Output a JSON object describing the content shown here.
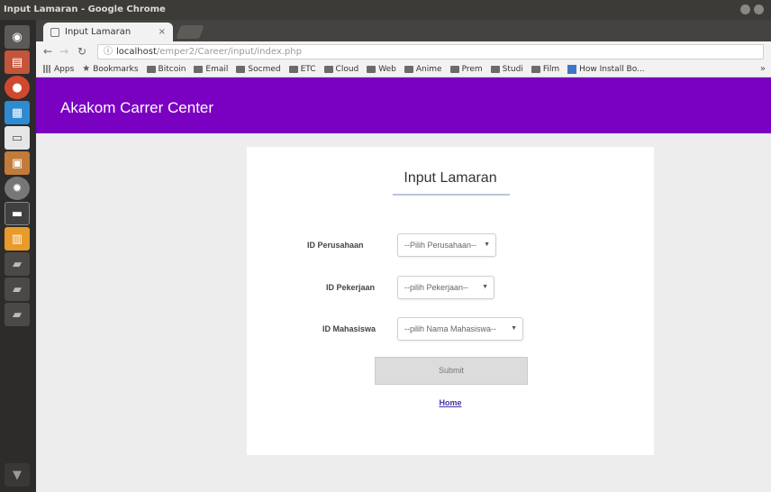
{
  "window": {
    "title": "Input Lamaran - Google Chrome"
  },
  "launcher": {
    "items": [
      {
        "icon": "dash-icon",
        "color": "#5c5a57"
      },
      {
        "icon": "files-icon",
        "color": "#c4553b"
      },
      {
        "icon": "chrome-icon",
        "color": "#d0492f"
      },
      {
        "icon": "doc-icon",
        "color": "#2f8bd1"
      },
      {
        "icon": "text-editor-icon",
        "color": "#e6e6e6"
      },
      {
        "icon": "package-icon",
        "color": "#c27b3a"
      },
      {
        "icon": "settings-icon",
        "color": "#777777"
      },
      {
        "icon": "terminal-icon",
        "color": "#404040"
      },
      {
        "icon": "software-center-icon",
        "color": "#e89a2a"
      },
      {
        "icon": "drive-icon",
        "color": "#bbbbbb"
      },
      {
        "icon": "drive-icon-2",
        "color": "#bbbbbb"
      },
      {
        "icon": "drive-icon-3",
        "color": "#bbbbbb"
      },
      {
        "icon": "trash-icon",
        "color": "#999999"
      }
    ]
  },
  "browser": {
    "tab_label": "Input Lamaran",
    "tab_close": "×",
    "url_host": "localhost",
    "url_path": "/emper2/Career/input/index.php",
    "bookmarks": [
      {
        "label": "Apps",
        "icon": "apps-icon"
      },
      {
        "label": "Bookmarks",
        "icon": "star-icon"
      },
      {
        "label": "Bitcoin",
        "icon": "folder-icon"
      },
      {
        "label": "Email",
        "icon": "folder-icon"
      },
      {
        "label": "Socmed",
        "icon": "folder-icon"
      },
      {
        "label": "ETC",
        "icon": "folder-icon"
      },
      {
        "label": "Cloud",
        "icon": "folder-icon"
      },
      {
        "label": "Web",
        "icon": "folder-icon"
      },
      {
        "label": "Anime",
        "icon": "folder-icon"
      },
      {
        "label": "Prem",
        "icon": "folder-icon"
      },
      {
        "label": "Studi",
        "icon": "folder-icon"
      },
      {
        "label": "Film",
        "icon": "folder-icon"
      },
      {
        "label": "How Install Bo...",
        "icon": "grid-icon"
      }
    ],
    "bookmarks_more": "»"
  },
  "site": {
    "title": "Akakom Carrer Center"
  },
  "form": {
    "title": "Input Lamaran",
    "fields": [
      {
        "label": "ID Perusahaan",
        "selected": "--Pilih Perusahaan--"
      },
      {
        "label": "ID Pekerjaan",
        "selected": "--pilih Pekerjaan--"
      },
      {
        "label": "ID Mahasiswa",
        "selected": "--pilih Nama Mahasiswa--"
      }
    ],
    "submit_label": "Submit",
    "home_link": "Home"
  },
  "colors": {
    "header": "#7a00c2",
    "card": "#ffffff",
    "page_bg": "#ededed"
  }
}
